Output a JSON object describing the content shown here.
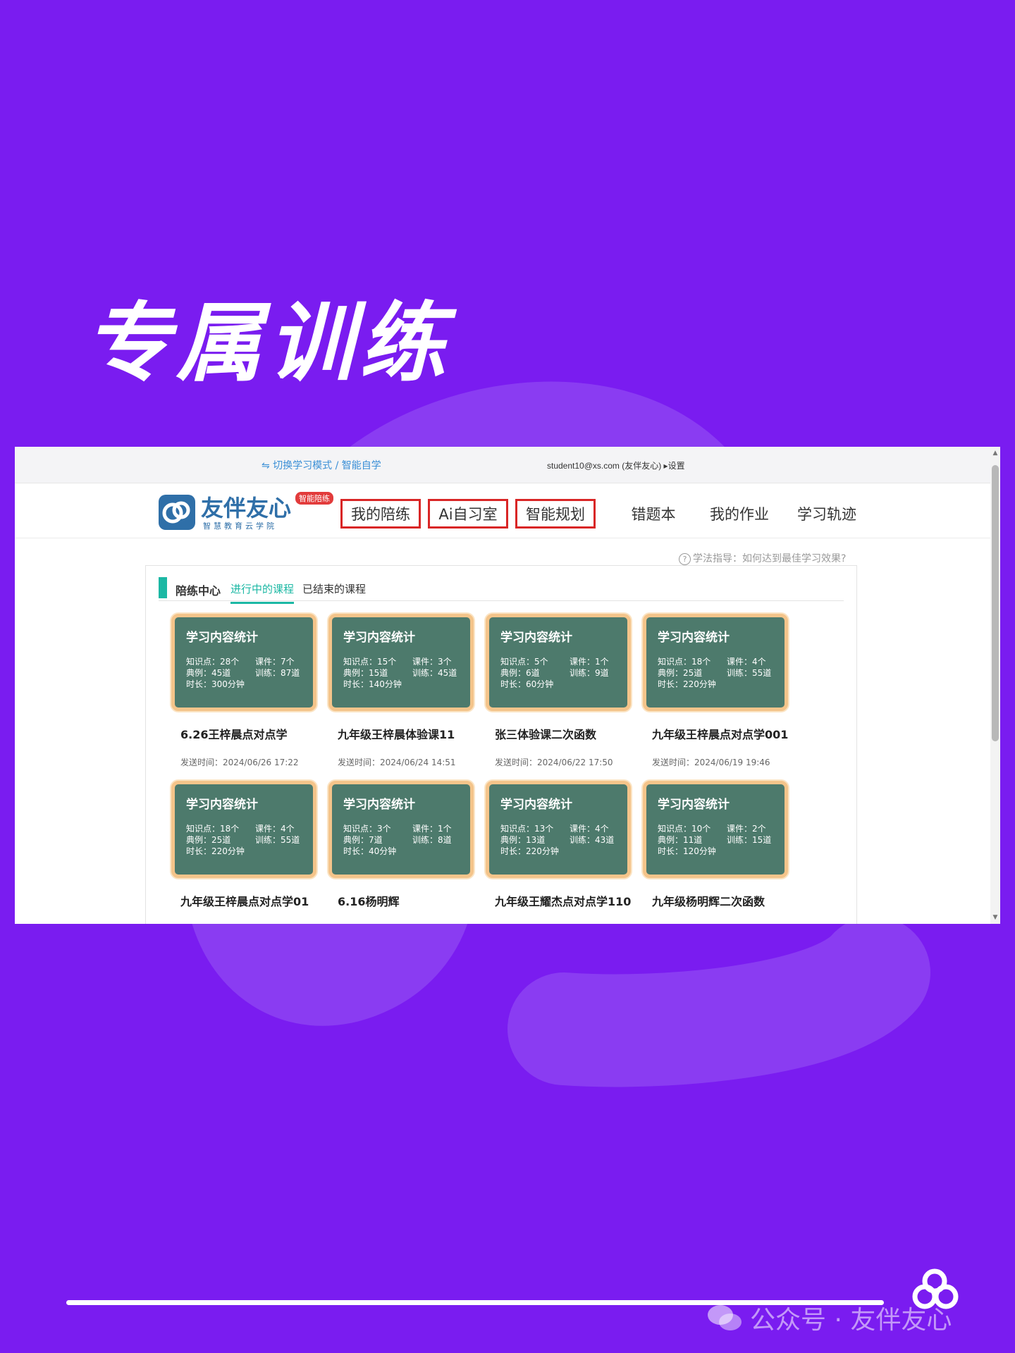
{
  "hero": {
    "title": "专属训练"
  },
  "topbar": {
    "switch_mode": "⇋ 切换学习模式 / 智能自学",
    "user": "student10@xs.com (友伴友心) ▸设置"
  },
  "brand": {
    "name": "友伴友心",
    "subtitle": "智慧教育云学院",
    "badge": "智能陪练"
  },
  "nav": [
    {
      "label": "我的陪练",
      "highlighted": true
    },
    {
      "label": "Ai自习室",
      "highlighted": true
    },
    {
      "label": "智能规划",
      "highlighted": true
    },
    {
      "label": "错题本",
      "highlighted": false
    },
    {
      "label": "我的作业",
      "highlighted": false
    },
    {
      "label": "学习轨迹",
      "highlighted": false
    }
  ],
  "hint": "学法指导：如何达到最佳学习效果?",
  "tabs": {
    "heading": "陪练中心",
    "items": [
      {
        "label": "进行中的课程",
        "active": true
      },
      {
        "label": "已结束的课程",
        "active": false
      }
    ]
  },
  "courses": [
    {
      "card_title": "学习内容统计",
      "knowledge": "知识点：28个",
      "courseware": "课件：7个",
      "examples": "典例：45道",
      "training": "训练：87道",
      "duration": "时长：300分钟",
      "name": "6.26王梓晨点对点学",
      "sent": "发送时间：2024/06/26 17:22"
    },
    {
      "card_title": "学习内容统计",
      "knowledge": "知识点：15个",
      "courseware": "课件：3个",
      "examples": "典例：15道",
      "training": "训练：45道",
      "duration": "时长：140分钟",
      "name": "九年级王梓晨体验课11",
      "sent": "发送时间：2024/06/24 14:51"
    },
    {
      "card_title": "学习内容统计",
      "knowledge": "知识点：5个",
      "courseware": "课件：1个",
      "examples": "典例：6道",
      "training": "训练：9道",
      "duration": "时长：60分钟",
      "name": "张三体验课二次函数",
      "sent": "发送时间：2024/06/22 17:50"
    },
    {
      "card_title": "学习内容统计",
      "knowledge": "知识点：18个",
      "courseware": "课件：4个",
      "examples": "典例：25道",
      "training": "训练：55道",
      "duration": "时长：220分钟",
      "name": "九年级王梓晨点对点学001",
      "sent": "发送时间：2024/06/19 19:46"
    },
    {
      "card_title": "学习内容统计",
      "knowledge": "知识点：18个",
      "courseware": "课件：4个",
      "examples": "典例：25道",
      "training": "训练：55道",
      "duration": "时长：220分钟",
      "name": "九年级王梓晨点对点学01",
      "sent": ""
    },
    {
      "card_title": "学习内容统计",
      "knowledge": "知识点：3个",
      "courseware": "课件：1个",
      "examples": "典例：7道",
      "training": "训练：8道",
      "duration": "时长：40分钟",
      "name": "6.16杨明辉",
      "sent": ""
    },
    {
      "card_title": "学习内容统计",
      "knowledge": "知识点：13个",
      "courseware": "课件：4个",
      "examples": "典例：13道",
      "training": "训练：43道",
      "duration": "时长：220分钟",
      "name": "九年级王耀杰点对点学110",
      "sent": ""
    },
    {
      "card_title": "学习内容统计",
      "knowledge": "知识点：10个",
      "courseware": "课件：2个",
      "examples": "典例：11道",
      "training": "训练：15道",
      "duration": "时长：120分钟",
      "name": "九年级杨明辉二次函数",
      "sent": ""
    }
  ],
  "footer": {
    "watermark": "公众号 · 友伴友心"
  },
  "colors": {
    "background": "#7a1cf0",
    "card": "#4d7a6c",
    "card_border": "#f4c48a",
    "accent": "#1cb8a4",
    "highlight": "#d92626"
  }
}
